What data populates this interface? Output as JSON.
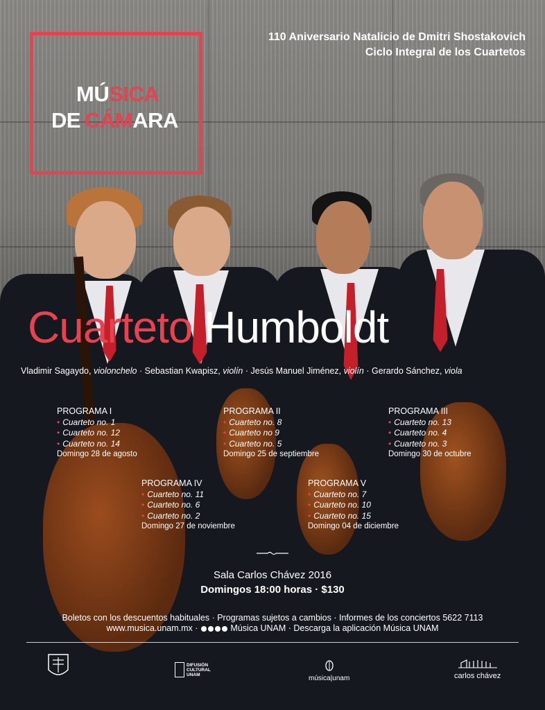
{
  "header": {
    "line1": "110 Aniversario Natalicio de Dmitri Shostakovich",
    "line2": "Ciclo Integral de los Cuartetos"
  },
  "logo": {
    "word1_red": "MÚ",
    "word1_rest": "SICA",
    "word2_de": "DE",
    "word2_a": "CÁM",
    "word2_b": "ARA"
  },
  "title": {
    "part1": "Cuarteto",
    "part2": "Humboldt"
  },
  "members": [
    {
      "name": "Vladimir Sagaydo,",
      "role": "violonchelo"
    },
    {
      "name": "Sebastian Kwapisz,",
      "role": "violín"
    },
    {
      "name": "Jesús Manuel Jiménez,",
      "role": "violín"
    },
    {
      "name": "Gerardo Sánchez,",
      "role": "viola"
    }
  ],
  "separator": "·",
  "bullet": "•",
  "programs": [
    {
      "title": "PROGRAMA I",
      "works": [
        "Cuarteto no. 1",
        "Cuarteto no. 12",
        "Cuarteto no. 14"
      ],
      "date": "Domingo 28 de agosto"
    },
    {
      "title": "PROGRAMA II",
      "works": [
        "Cuarteto no. 8",
        "Cuarteto no 9",
        "Cuarteto no. 5"
      ],
      "date": "Domingo 25 de septiembre"
    },
    {
      "title": "PROGRAMA III",
      "works": [
        "Cuarteto no. 13",
        "Cuarteto no. 4",
        "Cuarteto no. 3"
      ],
      "date": "Domingo 30 de octubre"
    },
    {
      "title": "PROGRAMA IV",
      "works": [
        "Cuarteto no. 11",
        "Cuarteto no. 6",
        "Cuarteto no. 2"
      ],
      "date": "Domingo 27 de noviembre"
    },
    {
      "title": "PROGRAMA V",
      "works": [
        "Cuarteto no. 7",
        "Cuarteto no. 10",
        "Cuarteto no. 15"
      ],
      "date": "Domingo 04 de diciembre"
    }
  ],
  "venue": {
    "line1": "Sala Carlos Chávez 2016",
    "line2": "Domingos 18:00 horas · $130"
  },
  "info": {
    "line1": "Boletos con los descuentos habituales · Programas sujetos a cambios · Informes de los conciertos 5622 7113",
    "line2_url": "www.musica.unam.mx ·",
    "line2_social": "Música UNAM · Descarga la aplicación Música UNAM"
  },
  "footer": {
    "difusion": [
      "DIFUSIÓN",
      "CULTURAL",
      "UNAM"
    ],
    "musica_unam": "música|unam",
    "carlos_chavez": "carlos chávez"
  },
  "colors": {
    "accent": "#e8414f",
    "tie": "#c4202c"
  }
}
